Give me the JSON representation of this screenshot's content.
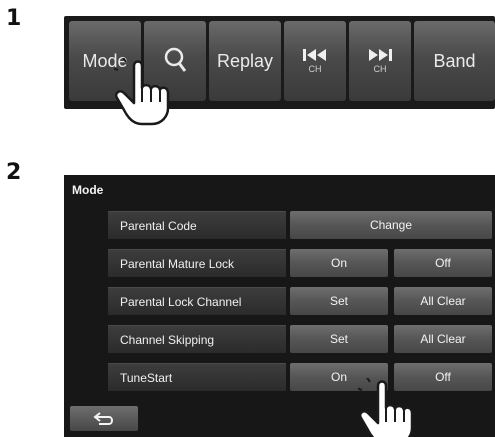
{
  "steps": {
    "one": "1",
    "two": "2"
  },
  "toolbar": {
    "mode": "Mode",
    "search_icon": "search-icon",
    "replay": "Replay",
    "prev_sub": "CH",
    "next_sub": "CH",
    "band": "Band"
  },
  "dialog": {
    "title": "Mode",
    "rows": [
      {
        "label": "Parental Code",
        "buttons": [
          "Change"
        ]
      },
      {
        "label": "Parental Mature Lock",
        "buttons": [
          "On",
          "Off"
        ]
      },
      {
        "label": "Parental Lock Channel",
        "buttons": [
          "Set",
          "All Clear"
        ]
      },
      {
        "label": "Channel Skipping",
        "buttons": [
          "Set",
          "All Clear"
        ]
      },
      {
        "label": "TuneStart",
        "buttons": [
          "On",
          "Off"
        ]
      }
    ],
    "back_icon": "back-arrow-icon"
  },
  "colors": {
    "panel": "#171717",
    "button": "#5a5a5a",
    "text": "#f0f0f0"
  }
}
